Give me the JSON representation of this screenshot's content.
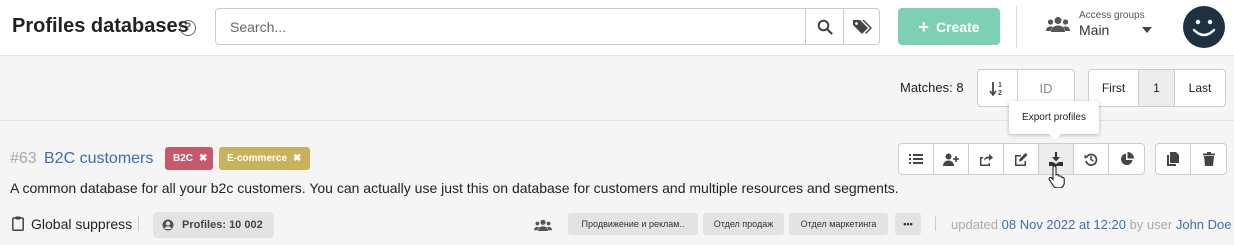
{
  "header": {
    "title": "Profiles databases",
    "help_icon": "question-circle-icon",
    "search_placeholder": "Search...",
    "search_value": "",
    "create_label": "Create",
    "create_color": "#7dcfb6",
    "access_groups_caption": "Access groups",
    "access_groups_value": "Main"
  },
  "toolbar": {
    "matches_label": "Matches: 8",
    "sort_field": "ID",
    "pager_first": "First",
    "pager_current": "1",
    "pager_last": "Last"
  },
  "tooltip": {
    "text": "Export profiles"
  },
  "database": {
    "id": "#63",
    "name": "B2C customers",
    "tags": [
      {
        "label": "B2C",
        "color": "#c65a6c"
      },
      {
        "label": "E-commerce",
        "color": "#c8b35c"
      }
    ],
    "description": "A common database for all your b2c customers. You can actually use just this on database for customers and multiple resources and segments.",
    "suppress_label": "Global suppress",
    "profiles_label": "Profiles: 10 002",
    "groups": [
      "Продвижение и реклам..",
      "Отдел продаж",
      "Отдел маркетинга",
      "•••"
    ],
    "updated_prefix": "updated",
    "updated_date": "08 Nov 2022 at 12:20",
    "updated_by": "by user",
    "updated_user": "John Doe",
    "actions": [
      "list-icon",
      "add-user-icon",
      "share-icon",
      "edit-icon",
      "download-icon",
      "history-icon",
      "pie-chart-icon"
    ],
    "extra_actions": [
      "copy-icon",
      "trash-icon"
    ]
  }
}
